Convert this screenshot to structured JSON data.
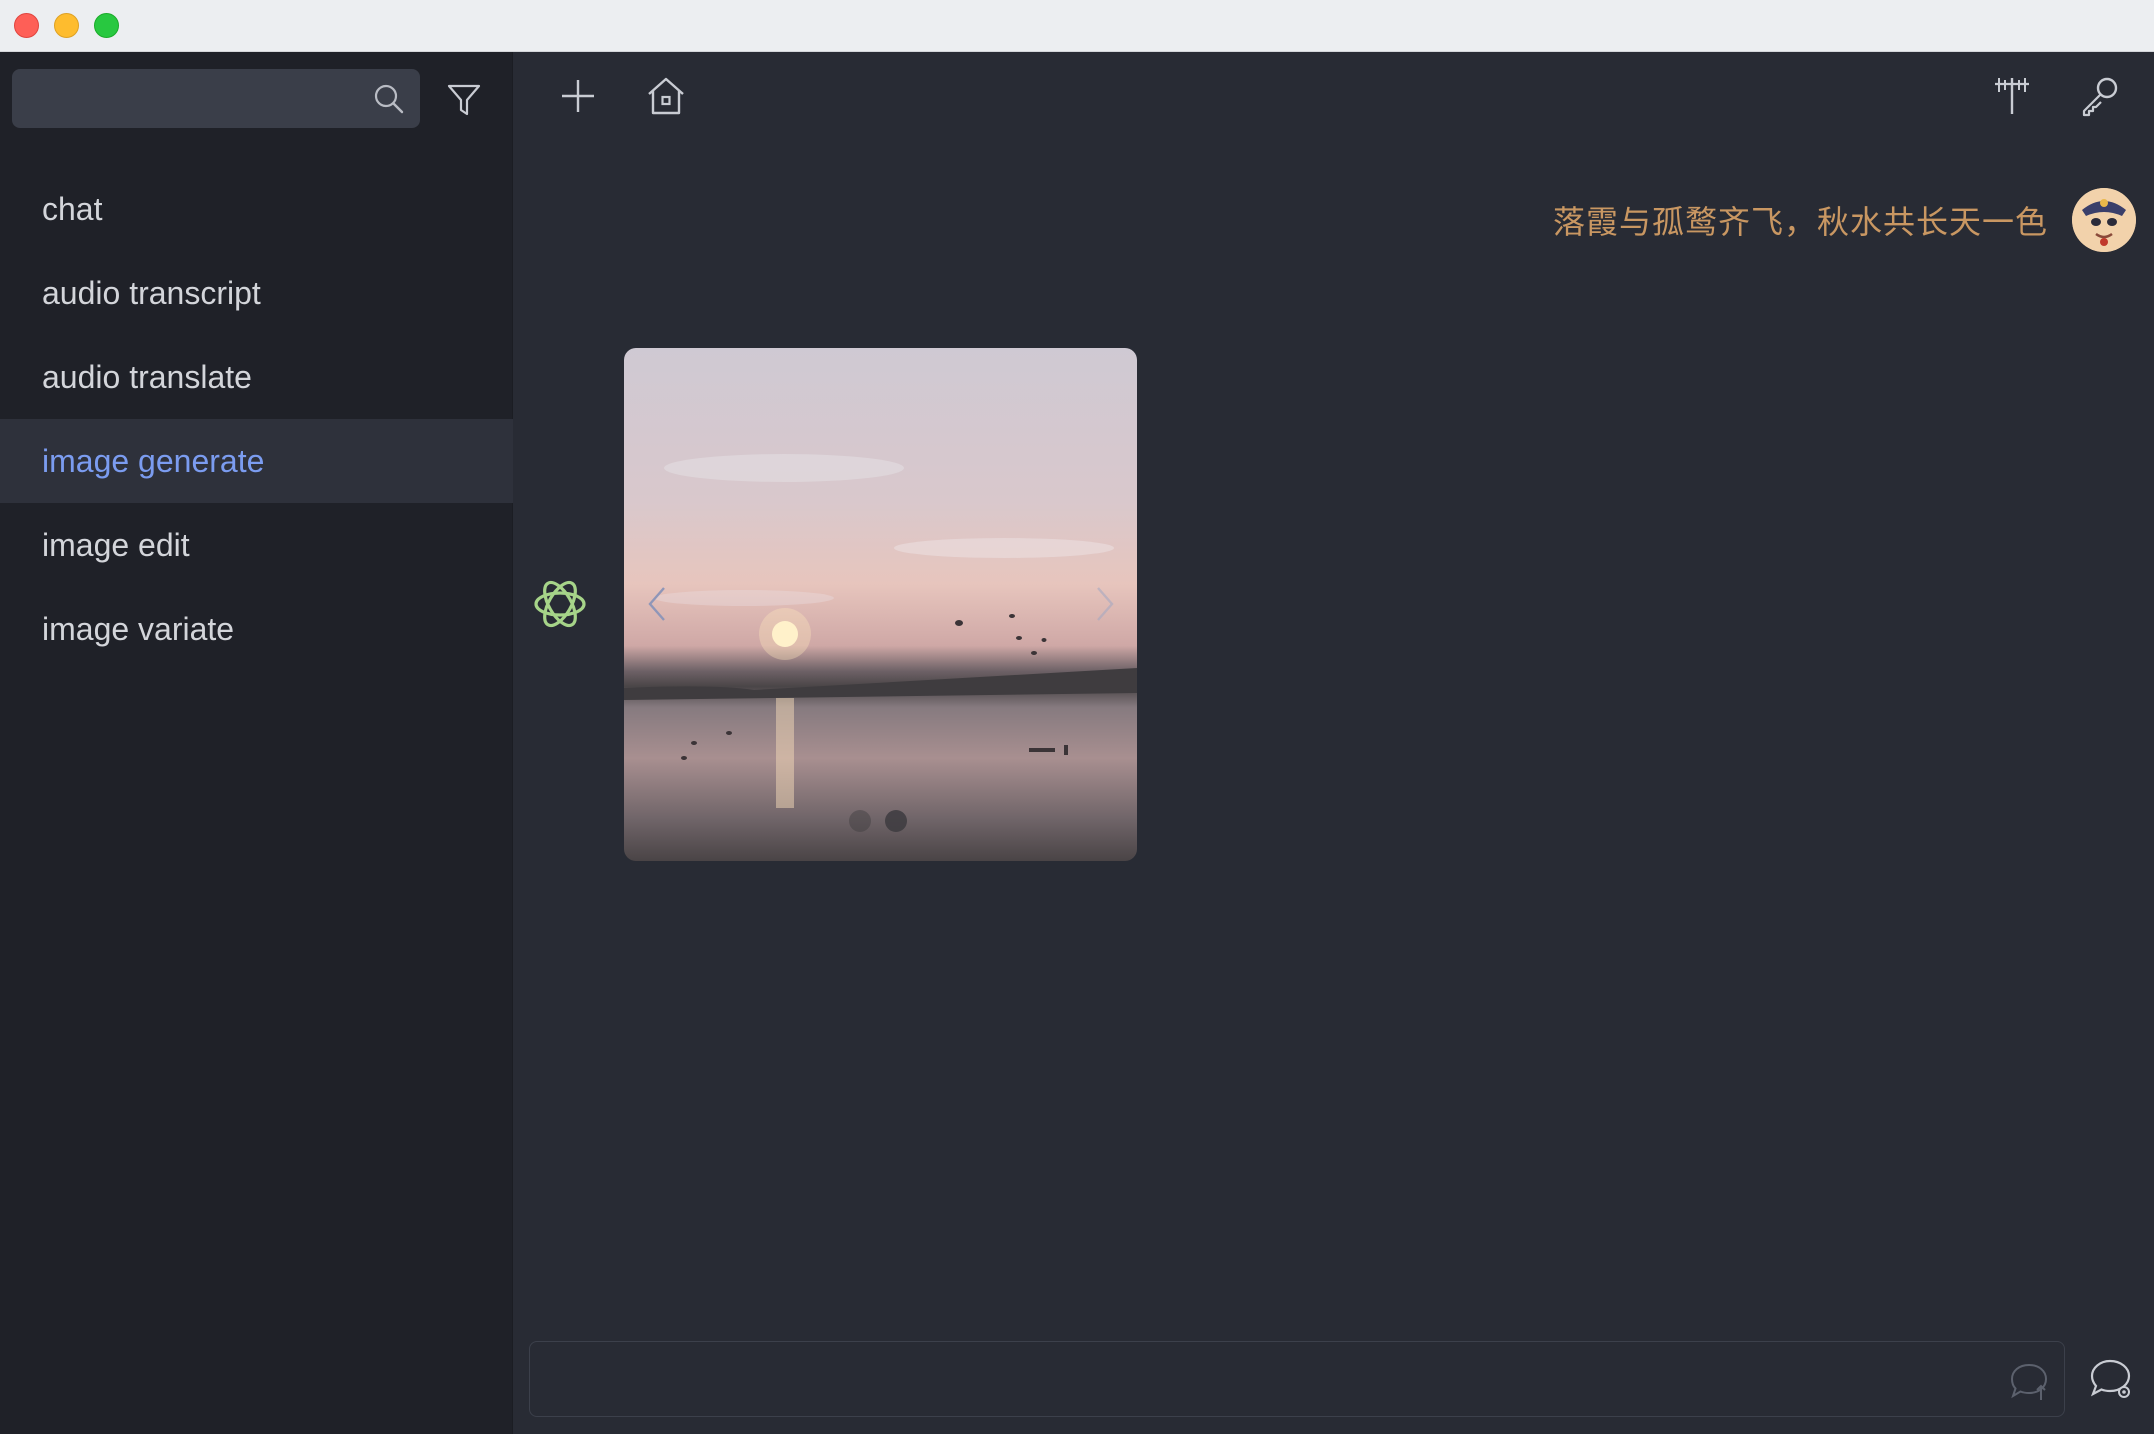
{
  "window": {
    "controls": [
      "close",
      "minimize",
      "maximize"
    ]
  },
  "sidebar": {
    "search": {
      "value": "",
      "placeholder": ""
    },
    "icons": {
      "search": "search-icon",
      "filter": "filter-icon"
    },
    "items": [
      {
        "label": "chat",
        "active": false
      },
      {
        "label": "audio transcript",
        "active": false
      },
      {
        "label": "audio translate",
        "active": false
      },
      {
        "label": "image generate",
        "active": true
      },
      {
        "label": "image edit",
        "active": false
      },
      {
        "label": "image variate",
        "active": false
      }
    ]
  },
  "toolbar": {
    "icons": [
      "plus-icon",
      "home-icon",
      "antenna-icon",
      "key-icon"
    ]
  },
  "conversation": {
    "user_message": "落霞与孤鹜齐飞，秋水共长天一色",
    "image_carousel": {
      "current": 2,
      "total": 2
    }
  },
  "composer": {
    "value": "",
    "placeholder": ""
  },
  "colors": {
    "sidebar_bg": "#1f2128",
    "main_bg": "#282b34",
    "active_item": "#7b9cf0",
    "user_text": "#c99762",
    "bot_logo": "#a6d489"
  }
}
